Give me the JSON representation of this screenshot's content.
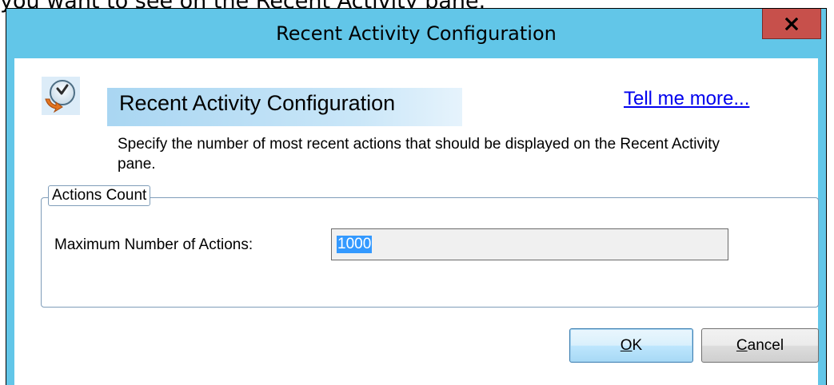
{
  "background": {
    "partial_text": "you want to see on the Recent Activity pane."
  },
  "window": {
    "title": "Recent Activity Configuration",
    "close_label": "x"
  },
  "header": {
    "icon": "clock-arrow-icon",
    "title": "Recent Activity Configuration",
    "help_link": "Tell me more...",
    "description": "Specify the number of most recent actions that should be displayed on the Recent Activity pane."
  },
  "group": {
    "legend": "Actions Count",
    "field_label": "Maximum Number of Actions:",
    "field_value": "1000"
  },
  "buttons": {
    "ok": {
      "mnemonic": "O",
      "rest": "K"
    },
    "cancel": {
      "mnemonic": "C",
      "rest": "ancel"
    }
  },
  "colors": {
    "titlebar": "#62c6e8",
    "close_button": "#c7504b",
    "selection": "#3399ff",
    "link": "#0000ee"
  }
}
